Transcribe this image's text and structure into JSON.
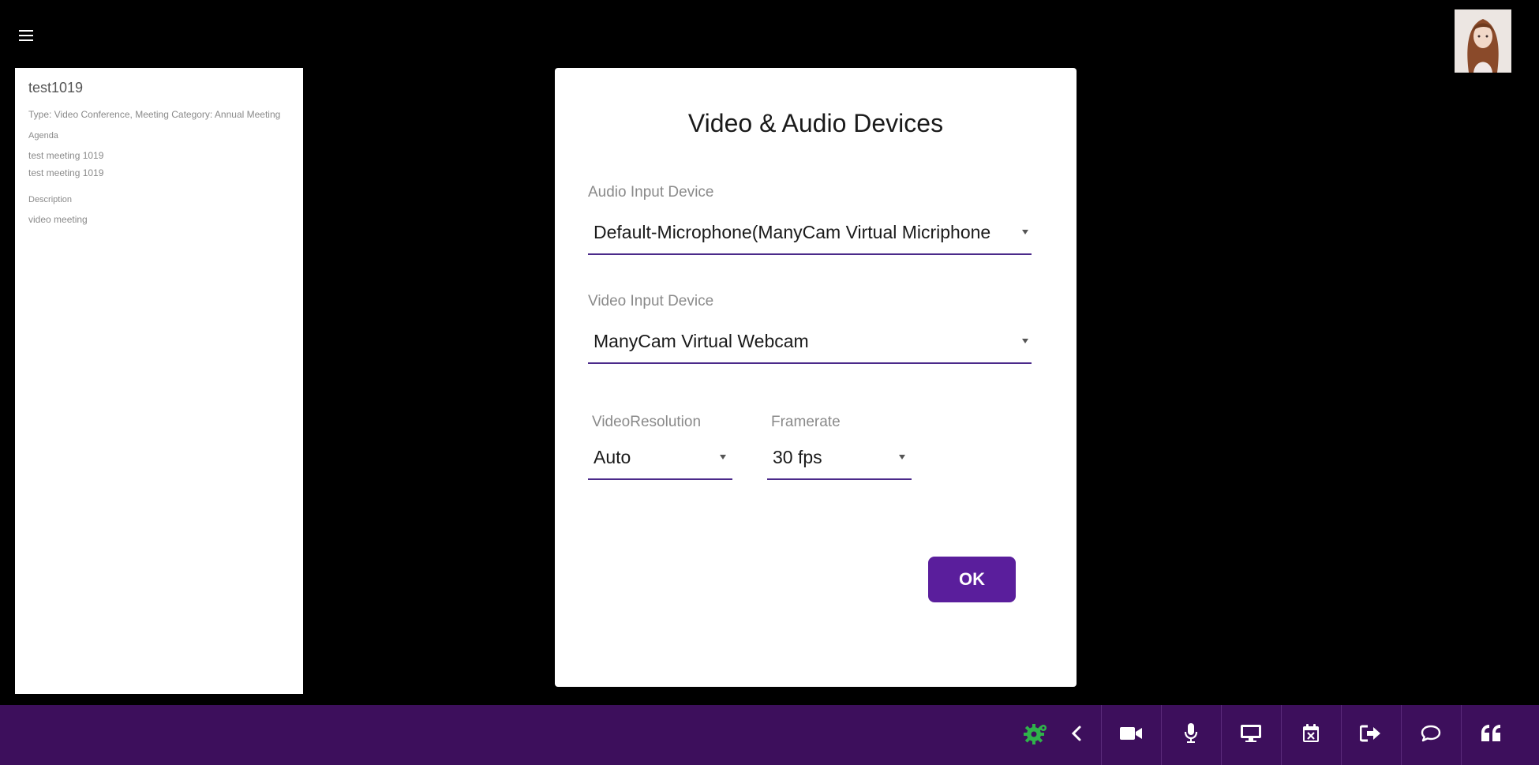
{
  "meeting": {
    "title": "test1019",
    "type_line": "Type: Video Conference, Meeting Category: Annual Meeting",
    "agenda_label": "Agenda",
    "agenda_items": [
      "test meeting 1019",
      "test meeting 1019"
    ],
    "description_label": "Description",
    "description": "video meeting"
  },
  "dialog": {
    "title": "Video & Audio Devices",
    "audio_label": "Audio Input Device",
    "audio_value": "Default-Microphone(ManyCam Virtual Micriphone",
    "video_label": "Video Input Device",
    "video_value": "ManyCam Virtual Webcam",
    "resolution_label": "VideoResolution",
    "resolution_value": "Auto",
    "framerate_label": "Framerate",
    "framerate_value": "30 fps",
    "ok_label": "OK"
  },
  "toolbar": {
    "icons": [
      "settings-icon",
      "chevron-left-icon",
      "video-camera-icon",
      "microphone-icon",
      "screen-share-icon",
      "calendar-icon",
      "leave-icon",
      "chat-icon",
      "quote-icon"
    ]
  },
  "colors": {
    "accent": "#5a1e9c",
    "toolbar_bg": "#3d0f5c",
    "settings_icon": "#2fb34a",
    "select_underline": "#4b2a8a"
  }
}
